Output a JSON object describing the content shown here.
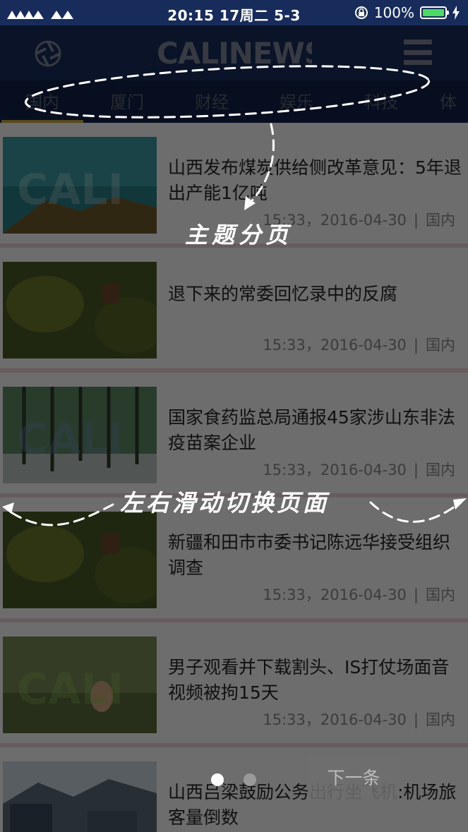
{
  "status_bar": {
    "time": "20:15 17周二 5-3",
    "battery": "100%",
    "battery_level": 1.0
  },
  "header": {
    "logo_text": "CALINEWS",
    "left_icon": "camera-shutter-icon",
    "right_icon": "hamburger-menu-icon"
  },
  "tabs": [
    {
      "label": "国内",
      "active": true
    },
    {
      "label": "厦门"
    },
    {
      "label": "财经"
    },
    {
      "label": "娱乐"
    },
    {
      "label": "科技"
    },
    {
      "label": "体"
    }
  ],
  "news": [
    {
      "title": "山西发布煤炭供给侧改革意见：5年退出产能1亿吨",
      "time": "15:33",
      "date": "2016-04-30",
      "category": "国内"
    },
    {
      "title": "退下来的常委回忆录中的反腐",
      "time": "15:33",
      "date": "2016-04-30",
      "category": "国内"
    },
    {
      "title": "国家食药监总局通报45家涉山东非法疫苗案企业",
      "time": "15:33",
      "date": "2016-04-30",
      "category": "国内"
    },
    {
      "title": "新疆和田市市委书记陈远华接受组织调查",
      "time": "15:33",
      "date": "2016-04-30",
      "category": "国内"
    },
    {
      "title": "男子观看并下载割头、IS打仗场面音视频被拘15天",
      "time": "15:33",
      "date": "2016-04-30",
      "category": "国内"
    },
    {
      "title": "山西吕梁鼓励公务出行坐飞机:机场旅客量倒数",
      "time": "",
      "date": "",
      "category": ""
    }
  ],
  "overlay": {
    "tabs_hint": "主题分页",
    "swipe_hint": "左右滑动切换页面",
    "next_button": "下一条",
    "page_count": 2,
    "current_page": 1
  },
  "colors": {
    "header_bg": "#172c5a",
    "tab_bg": "#112148",
    "tab_indicator": "#c8a640",
    "battery": "#4cd964"
  }
}
